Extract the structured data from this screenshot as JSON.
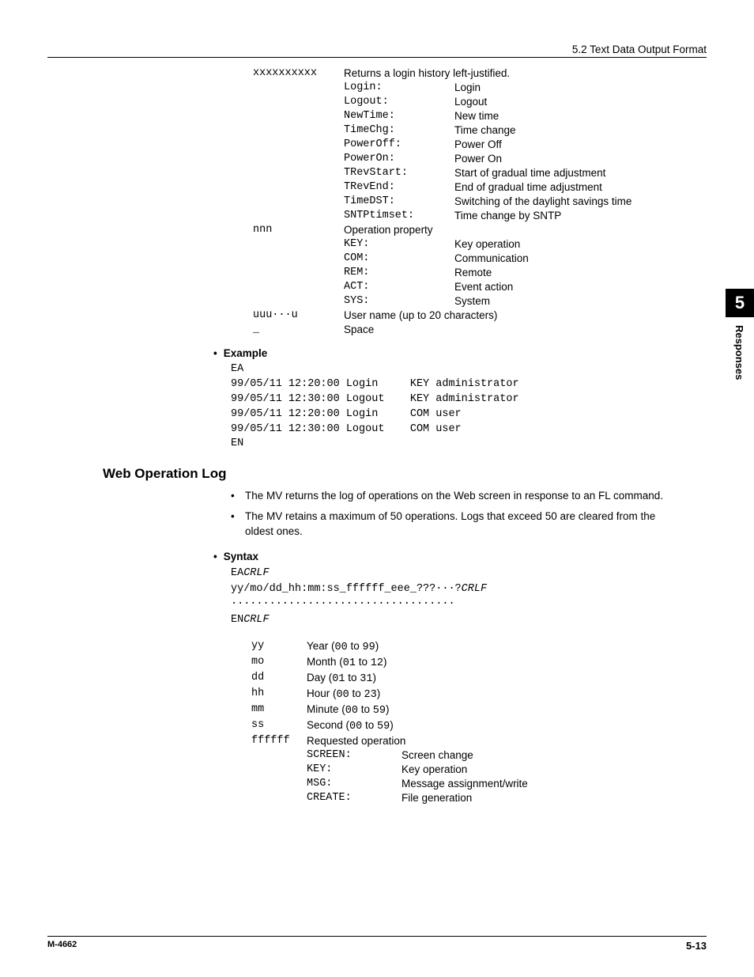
{
  "header": {
    "section": "5.2  Text Data Output Format"
  },
  "side_tab": {
    "chapter": "5",
    "title": "Responses"
  },
  "top_table": {
    "row1": {
      "code": "xxxxxxxxxx",
      "intro": "Returns a login history left-justified.",
      "pairs": [
        {
          "k": "Login:",
          "v": "Login"
        },
        {
          "k": "Logout:",
          "v": "Logout"
        },
        {
          "k": "NewTime:",
          "v": "New time"
        },
        {
          "k": "TimeChg:",
          "v": "Time change"
        },
        {
          "k": "PowerOff:",
          "v": "Power Off"
        },
        {
          "k": "PowerOn:",
          "v": "Power On"
        },
        {
          "k": "TRevStart:",
          "v": "Start of gradual time adjustment"
        },
        {
          "k": "TRevEnd:",
          "v": "End of gradual time adjustment"
        },
        {
          "k": "TimeDST:",
          "v": "Switching of the daylight savings time"
        },
        {
          "k": "SNTPtimset:",
          "v": "Time change by SNTP"
        }
      ]
    },
    "row2": {
      "code": "nnn",
      "intro": "Operation property",
      "pairs": [
        {
          "k": "KEY:",
          "v": "Key operation"
        },
        {
          "k": "COM:",
          "v": "Communication"
        },
        {
          "k": "REM:",
          "v": "Remote"
        },
        {
          "k": "ACT:",
          "v": "Event action"
        },
        {
          "k": "SYS:",
          "v": "System"
        }
      ]
    },
    "row3": {
      "code": "uuu···u",
      "intro": "User name (up to 20 characters)"
    },
    "row4": {
      "code": "_",
      "intro": "Space"
    }
  },
  "example": {
    "heading": "Example",
    "lines": [
      "EA",
      "99/05/11 12:20:00 Login     KEY administrator",
      "99/05/11 12:30:00 Logout    KEY administrator",
      "99/05/11 12:20:00 Login     COM user",
      "99/05/11 12:30:00 Logout    COM user",
      "EN"
    ]
  },
  "section": {
    "title": "Web Operation Log",
    "notes": [
      "The MV returns the log of operations on the Web screen in response to an FL command.",
      "The MV retains a maximum of 50 operations. Logs that exceed 50 are cleared from the oldest ones."
    ]
  },
  "syntax": {
    "heading": "Syntax",
    "line1a": "EA",
    "line1b": "CRLF",
    "line2a": "yy/mo/dd_hh:mm:ss_ffffff_eee_???···?",
    "line2b": "CRLF",
    "dots": "···································",
    "line4a": "EN",
    "line4b": "CRLF",
    "params": [
      {
        "code": "yy",
        "label_a": "Year (",
        "label_b": "00",
        "label_c": " to ",
        "label_d": "99",
        "label_e": ")"
      },
      {
        "code": "mo",
        "label_a": "Month (",
        "label_b": "01",
        "label_c": " to ",
        "label_d": "12",
        "label_e": ")"
      },
      {
        "code": "dd",
        "label_a": "Day (",
        "label_b": "01",
        "label_c": " to ",
        "label_d": "31",
        "label_e": ")"
      },
      {
        "code": "hh",
        "label_a": "Hour (",
        "label_b": "00",
        "label_c": " to ",
        "label_d": "23",
        "label_e": ")"
      },
      {
        "code": "mm",
        "label_a": "Minute (",
        "label_b": "00",
        "label_c": " to ",
        "label_d": "59",
        "label_e": ")"
      },
      {
        "code": "ss",
        "label_a": "Second (",
        "label_b": "00",
        "label_c": " to ",
        "label_d": "59",
        "label_e": ")"
      }
    ],
    "reqop": {
      "code": "ffffff",
      "label": "Requested operation",
      "pairs": [
        {
          "k": "SCREEN:",
          "v": "Screen change"
        },
        {
          "k": "KEY:",
          "v": "Key operation"
        },
        {
          "k": "MSG:",
          "v": "Message assignment/write"
        },
        {
          "k": "CREATE:",
          "v": "File generation"
        }
      ]
    }
  },
  "footer": {
    "left": "M-4662",
    "right": "5-13"
  }
}
